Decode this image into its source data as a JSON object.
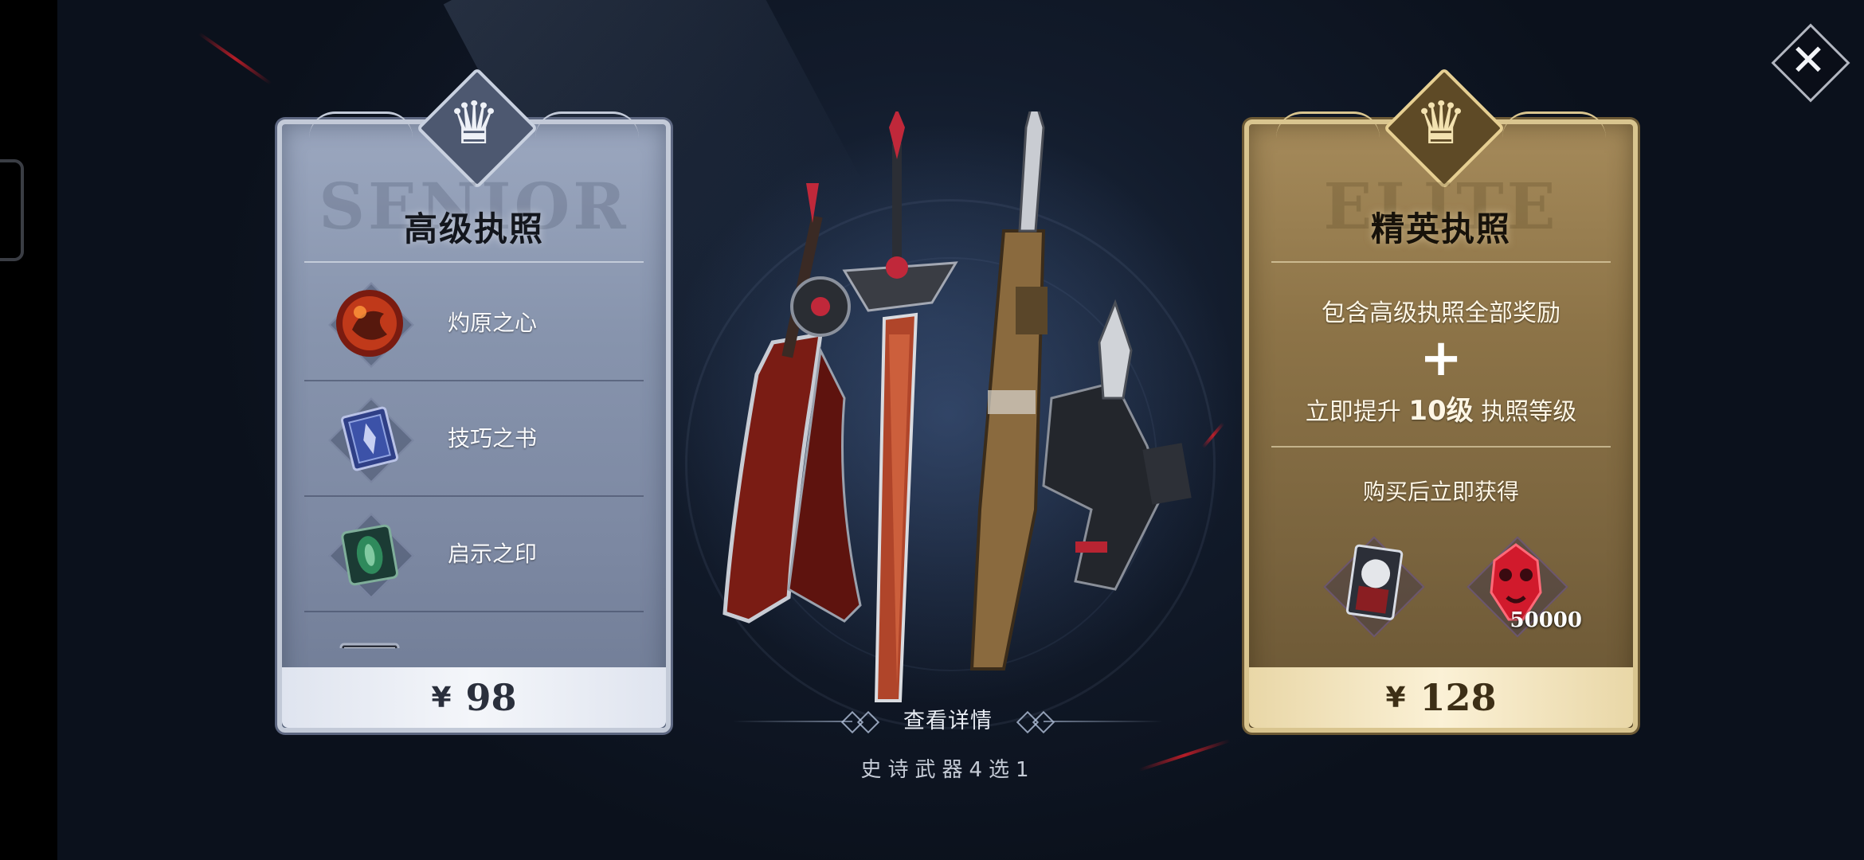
{
  "close": {
    "label": "✕"
  },
  "senior": {
    "watermark": "SENIOR",
    "title": "高级执照",
    "rewards": [
      {
        "label": "灼原之心",
        "icon": "fire-orb-icon"
      },
      {
        "label": "技巧之书",
        "icon": "book-icon"
      },
      {
        "label": "启示之印",
        "icon": "seal-icon"
      },
      {
        "label": "",
        "icon": "weapon-crate-icon"
      }
    ],
    "currency": "¥",
    "price": "98"
  },
  "elite": {
    "watermark": "ELITE",
    "title": "精英执照",
    "line1": "包含高级执照全部奖励",
    "plus": "+",
    "line2_pre": "立即提升",
    "line2_num": "10级",
    "line2_post": "执照等级",
    "bonus_title": "购买后立即获得",
    "bonus_items": [
      {
        "icon": "character-card-icon",
        "qty": ""
      },
      {
        "icon": "red-crystal-icon",
        "qty": "50000"
      }
    ],
    "currency": "¥",
    "price": "128"
  },
  "center": {
    "detail_label": "查看详情",
    "weapon_choice": "史诗武器4选1"
  },
  "colors": {
    "senior_frame": "#c3cad8",
    "elite_frame": "#d9c58f",
    "background": "#121b2b"
  }
}
